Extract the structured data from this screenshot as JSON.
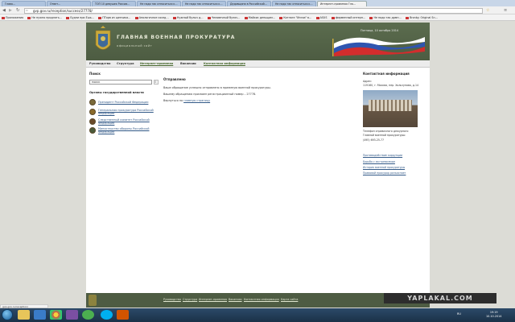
{
  "browser": {
    "tabs": [
      "Глава…",
      "Ответ…",
      "ТОП 10 девушек России…",
      "Не надо так относиться к…",
      "Не надо так относиться к…",
      "Дедовщина в Российской…",
      "Не надо так относиться к…",
      "Интернет-приемная Гла…"
    ],
    "url": "gvp.gov.ru/reception/success/27778/",
    "bookmarks": [
      "Приложения",
      "Не нужно продлять…",
      "Будни при Ешь…",
      "ПТорв из щенчика…",
      "Апологичное сосед…",
      "Нужный булыч д…",
      "Человечный булоч…",
      "Майхис деньщам…",
      "Котнаге \"Ингаа\" в…",
      "ASUS",
      "фирменный интерн…",
      "Не надо так дрмн…",
      "Bronby. Original Sn…"
    ]
  },
  "header": {
    "title": "ГЛАВНАЯ ВОЕННАЯ ПРОКУРАТУРА",
    "subtitle": "официальный сайт",
    "date": "Пятница, 10 октября 2014"
  },
  "nav": [
    "Руководство",
    "Структура",
    "Интернет-приемная",
    "Вакансии",
    "Контактная информация"
  ],
  "sidebar": {
    "search_title": "Поиск",
    "search_value": "поиск",
    "orgs_title": "Органы государственной власти",
    "orgs": [
      "Президент Российской Федерации",
      "Генеральная прокуратура Российской Федерации",
      "Следственный комитет Российской Федерации",
      "Министерство обороны Российской Федерации"
    ]
  },
  "main": {
    "title": "Отправлено",
    "line1": "Ваше обращение успешно отправлено в приемную военной прокуратуры.",
    "line2": "Вашему обращению присвоен регистрационный номер – 27778.",
    "back_prefix": "Вернуться на",
    "back_link": "главную страницу"
  },
  "contact": {
    "title": "Контактная информация",
    "address_label": "Адрес:",
    "address": "119160, г. Москва, пер. Хользунова, д.14",
    "phone_label": "Телефон справочного дежурного",
    "phone_org": "Главной военной прокуратуры:",
    "phone": "(495) 693-25-77",
    "links": [
      "Противодействие коррупции",
      "Борьба с экстремизмом",
      "История военной прокуратуры",
      "Правовой прокурор разъясняет"
    ]
  },
  "footer": {
    "links": [
      "Руководство",
      "Структура",
      "Интернет-приемная",
      "Вакансии",
      "Контактная информация",
      "Карта сайта"
    ]
  },
  "watermark": "YAPLAKAL.COM",
  "status_url": "gvp.gov.ru/reception/",
  "taskbar": {
    "lang": "RU",
    "time": "19:19",
    "date": "10.10.2014"
  }
}
